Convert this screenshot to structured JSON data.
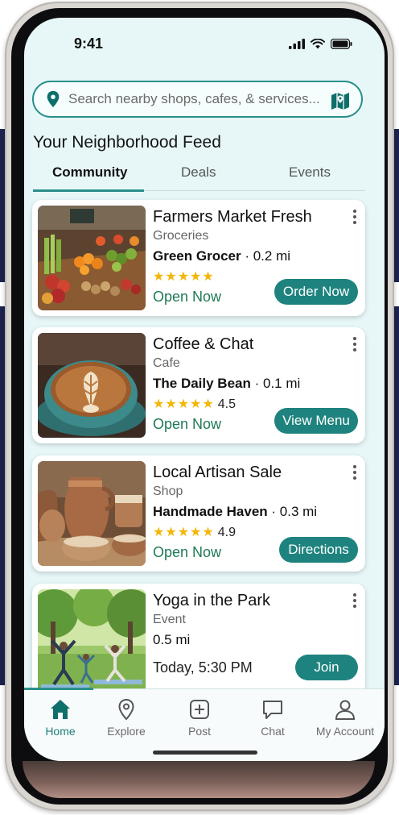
{
  "status": {
    "time": "9:41"
  },
  "search": {
    "placeholder": "Search nearby shops, cafes, & services..."
  },
  "feed": {
    "title": "Your Neighborhood Feed"
  },
  "tabs": [
    {
      "label": "Community",
      "active": true
    },
    {
      "label": "Deals",
      "active": false
    },
    {
      "label": "Events",
      "active": false
    }
  ],
  "cards": [
    {
      "title": "Farmers Market Fresh",
      "category": "Groceries",
      "store": "Green Grocer",
      "distance": "· 0.2 mi",
      "stars": "★★★★★",
      "rating": "",
      "status": "Open Now",
      "action": "Order Now",
      "image": "produce-stall-photo"
    },
    {
      "title": "Coffee & Chat",
      "category": "Cafe",
      "store": "The Daily Bean",
      "distance": "· 0.1 mi",
      "stars": "★★★★★",
      "rating": "4.5",
      "status": "Open Now",
      "action": "View Menu",
      "image": "latte-art-photo"
    },
    {
      "title": "Local Artisan Sale",
      "category": "Shop",
      "store": "Handmade Haven",
      "distance": "· 0.3 mi",
      "stars": "★★★★★",
      "rating": "4.9",
      "status": "Open Now",
      "action": "Directions",
      "image": "pottery-photo"
    },
    {
      "title": "Yoga in the Park",
      "category": "Event",
      "store": "",
      "distance": "0.5 mi",
      "stars": "",
      "rating": "",
      "status": "Today, 5:30 PM",
      "action": "Join",
      "image": "park-yoga-photo"
    }
  ],
  "nav": [
    {
      "label": "Home",
      "icon": "home-icon",
      "active": true
    },
    {
      "label": "Explore",
      "icon": "location-pin-icon",
      "active": false
    },
    {
      "label": "Post",
      "icon": "plus-square-icon",
      "active": false
    },
    {
      "label": "Chat",
      "icon": "chat-bubble-icon",
      "active": false
    },
    {
      "label": "My Account",
      "icon": "user-icon",
      "active": false
    }
  ],
  "colors": {
    "accent": "#1e837e",
    "open_status": "#1f7a55",
    "star": "#f2b705",
    "screen_bg": "#e7f7f8"
  }
}
